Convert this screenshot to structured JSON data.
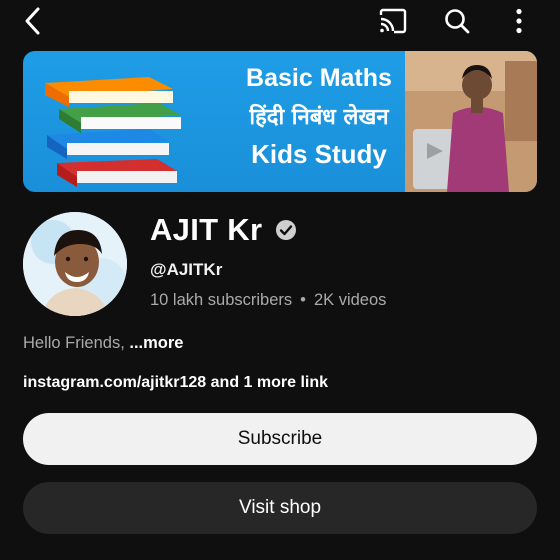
{
  "banner": {
    "line1": "Basic Maths",
    "line2": "हिंदी निबंध लेखन",
    "line3": "Kids Study"
  },
  "channel": {
    "name": "AJIT Kr",
    "handle": "@AJITKr",
    "subscribers": "10 lakh subscribers",
    "separator": "•",
    "videos": "2K videos",
    "description": "Hello Friends, ",
    "more_label": "...more",
    "links": "instagram.com/ajitkr128 and 1 more link"
  },
  "actions": {
    "subscribe_label": "Subscribe",
    "visit_shop_label": "Visit shop"
  },
  "icons": {
    "back": "chevron-left-icon",
    "cast": "cast-icon",
    "search": "search-icon",
    "more": "more-vert-icon",
    "verified": "verified-check-icon"
  },
  "colors": {
    "background": "#0f0f0f",
    "banner_blue": "#1e9de6",
    "subscribe_bg": "#f1f1f1",
    "secondary_btn_bg": "#272727",
    "muted_text": "#aaaaaa"
  }
}
